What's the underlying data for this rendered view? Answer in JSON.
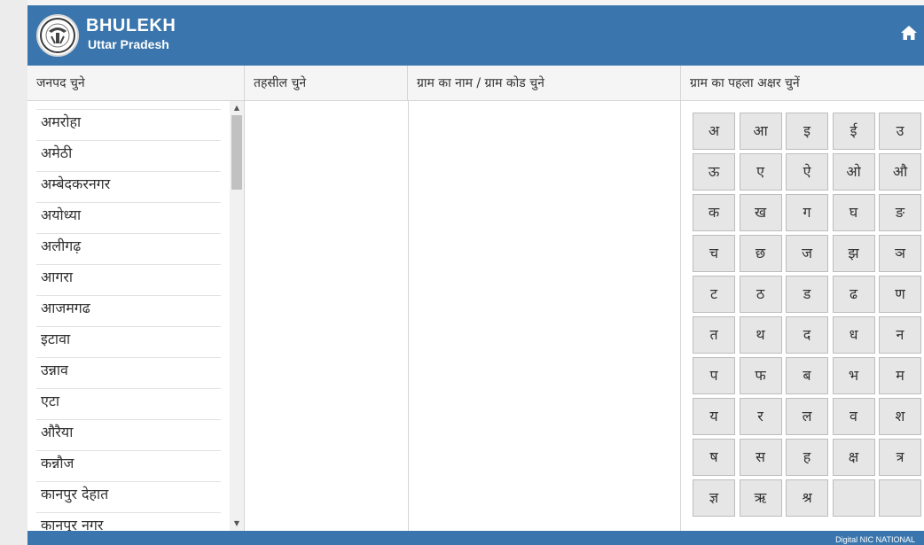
{
  "header": {
    "title": "BHULEKH",
    "subtitle": "Uttar Pradesh"
  },
  "columns": {
    "district": "जनपद चुने",
    "tehsil": "तहसील चुने",
    "village": "ग्राम का नाम / ग्राम कोड चुने",
    "first_letter": "ग्राम का पहला अक्षर चुनें"
  },
  "districts": [
    "अमरोहा",
    "अमेठी",
    "अम्बेदकरनगर",
    "अयोध्या",
    "अलीगढ़",
    "आगरा",
    "आजमगढ",
    "इटावा",
    "उन्नाव",
    "एटा",
    "औरैया",
    "कन्नौज",
    "कानपुर देहात",
    "कानपुर नगर"
  ],
  "letters": [
    [
      "अ",
      "आ",
      "इ",
      "ई",
      "उ"
    ],
    [
      "ऊ",
      "ए",
      "ऐ",
      "ओ",
      "औ"
    ],
    [
      "क",
      "ख",
      "ग",
      "घ",
      "ङ"
    ],
    [
      "च",
      "छ",
      "ज",
      "झ",
      "ञ"
    ],
    [
      "ट",
      "ठ",
      "ड",
      "ढ",
      "ण"
    ],
    [
      "त",
      "थ",
      "द",
      "ध",
      "न"
    ],
    [
      "प",
      "फ",
      "ब",
      "भ",
      "म"
    ],
    [
      "य",
      "र",
      "ल",
      "व",
      "श"
    ],
    [
      "ष",
      "स",
      "ह",
      "क्ष",
      "त्र"
    ],
    [
      "ज्ञ",
      "ऋ",
      "श्र",
      "",
      ""
    ]
  ],
  "footer": {
    "text": "Digital  NIC NATIONAL"
  },
  "colors": {
    "header": "#3a76ad",
    "button": "#e6e6e6"
  }
}
